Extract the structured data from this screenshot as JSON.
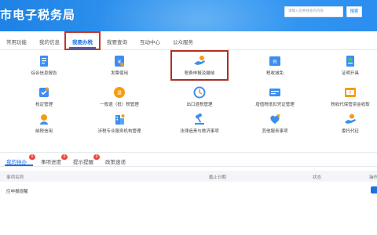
{
  "header": {
    "title": "市电子税务局",
    "search_placeholder": "请输入您要搜索的内容",
    "search_button": "搜索"
  },
  "main_tabs": [
    "常用功能",
    "我的信息",
    "我要办税",
    "我要查询",
    "互动中心",
    "公众服务"
  ],
  "active_tab": "我要办税",
  "services": [
    {
      "label": "综合信息报告",
      "icon": "info-report-icon"
    },
    {
      "label": "发票使用",
      "icon": "invoice-icon"
    },
    {
      "label": "税费申报及缴纳",
      "icon": "tax-declaration-icon"
    },
    {
      "label": "税收减免",
      "icon": "tax-reduction-icon"
    },
    {
      "label": "证明开具",
      "icon": "certificate-icon"
    },
    {
      "label": "核定管理",
      "icon": "verification-icon"
    },
    {
      "label": "一般退（抵）税管理",
      "icon": "tax-refund-icon"
    },
    {
      "label": "出口退税管理",
      "icon": "export-refund-icon"
    },
    {
      "label": "增值税抵扣凭证管理",
      "icon": "vat-deduction-icon"
    },
    {
      "label": "税收代保管资金收取",
      "icon": "custody-funds-icon"
    },
    {
      "label": "纳税信用",
      "icon": "tax-credit-icon"
    },
    {
      "label": "涉税专业服务机构管理",
      "icon": "agency-icon"
    },
    {
      "label": "法律追责与救济事项",
      "icon": "legal-icon"
    },
    {
      "label": "其他服务事项",
      "icon": "other-services-icon"
    },
    {
      "label": "委托代征",
      "icon": "entrusted-collection-icon"
    }
  ],
  "panel": {
    "tabs": [
      {
        "label": "我的待办",
        "badge": "0"
      },
      {
        "label": "事项进度",
        "badge": "0"
      },
      {
        "label": "提示提醒",
        "badge": "0"
      },
      {
        "label": "政策速递",
        "badge": ""
      }
    ],
    "columns": [
      "事项名称",
      "截止日期",
      "状态",
      "操作"
    ],
    "rows": [
      {
        "name": "应申报提醒"
      }
    ]
  },
  "colors": {
    "header_blue": "#1e82e6",
    "accent_blue": "#1e6fe0",
    "highlight_red": "#c0392b",
    "badge_red": "#e74c3c"
  }
}
